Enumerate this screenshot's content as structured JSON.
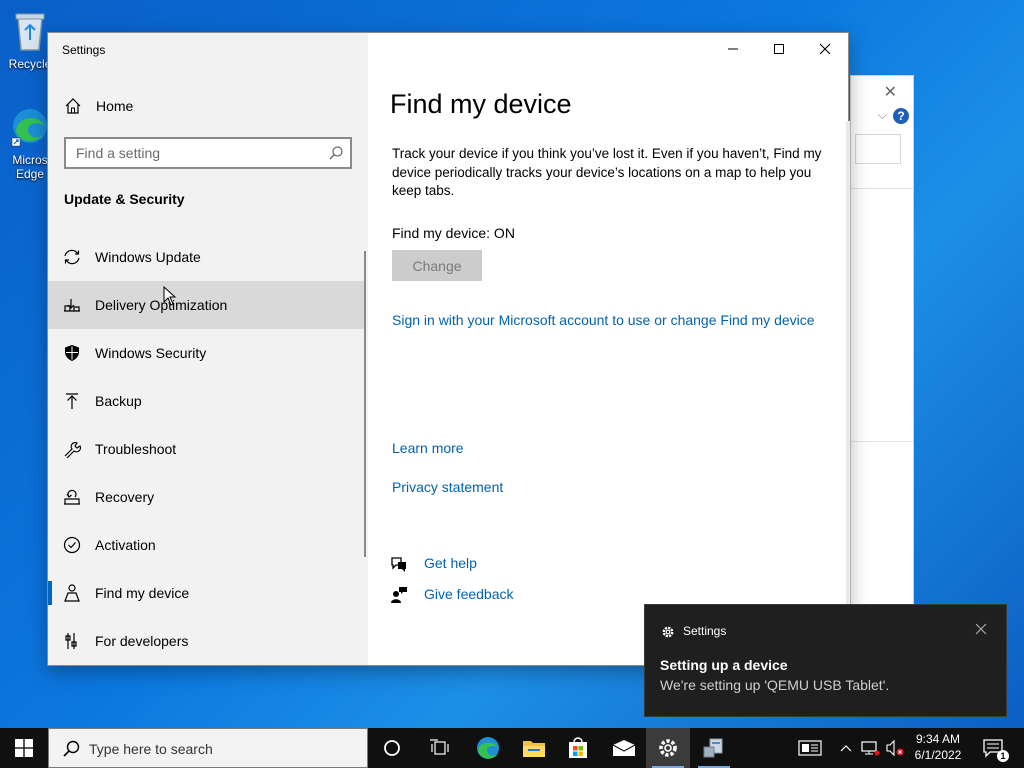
{
  "desktop": {
    "icons": [
      {
        "label": "Recycle"
      },
      {
        "label": "Micros Edge"
      }
    ]
  },
  "window": {
    "title": "Settings",
    "home_label": "Home",
    "search_placeholder": "Find a setting",
    "section_title": "Update & Security",
    "nav_items": [
      {
        "label": "Windows Update",
        "icon": "sync-icon"
      },
      {
        "label": "Delivery Optimization",
        "icon": "delivery-icon"
      },
      {
        "label": "Windows Security",
        "icon": "shield-icon"
      },
      {
        "label": "Backup",
        "icon": "backup-arrow-icon"
      },
      {
        "label": "Troubleshoot",
        "icon": "wrench-icon"
      },
      {
        "label": "Recovery",
        "icon": "recovery-icon"
      },
      {
        "label": "Activation",
        "icon": "check-circle-icon"
      },
      {
        "label": "Find my device",
        "icon": "person-location-icon"
      },
      {
        "label": "For developers",
        "icon": "developer-tools-icon"
      }
    ],
    "selected_item": "Find my device",
    "hovered_item": "Delivery Optimization"
  },
  "content": {
    "title": "Find my device",
    "description": "Track your device if you think you’ve lost it. Even if you haven’t, Find my device periodically tracks your device’s locations on a map to help you keep tabs.",
    "status": "Find my device: ON",
    "change_button": "Change",
    "signin_link": "Sign in with your Microsoft account to use or change Find my device",
    "learn_more": "Learn more",
    "privacy": "Privacy statement",
    "get_help": "Get help",
    "give_feedback": "Give feedback"
  },
  "toast": {
    "app": "Settings",
    "title": "Setting up a device",
    "body": "We're setting up 'QEMU USB Tablet'."
  },
  "taskbar": {
    "search_placeholder": "Type here to search",
    "time": "9:34 AM",
    "date": "6/1/2022",
    "notification_count": "1"
  },
  "colors": {
    "accent": "#0067c0",
    "link": "#0063b1",
    "sidebar_bg": "#f2f2f2"
  }
}
